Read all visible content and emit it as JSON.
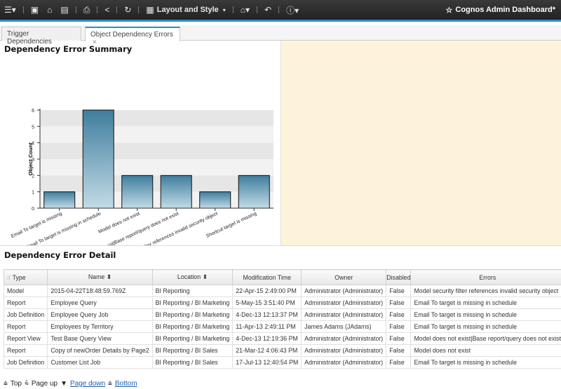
{
  "toolbar": {
    "layout_label": "Layout and Style",
    "title": "Cognos Admin Dashboard*"
  },
  "tabs": [
    {
      "label": "Trigger Dependencies"
    },
    {
      "label": "Object Dependency Errors"
    }
  ],
  "summary": {
    "title": "Dependency Error Summary"
  },
  "chart_data": {
    "type": "bar",
    "ylabel": "Object Count",
    "ylim": [
      0,
      6
    ],
    "yticks": [
      0,
      1,
      2,
      3,
      4,
      5,
      6
    ],
    "grid": true,
    "categories": [
      "Email To target is missing",
      "Email To target is missing in schedule",
      "Model does not exist",
      "Model does not exist|Base report/query does not exist",
      "Model security filter references invalid security object",
      "Shortcut target is missing"
    ],
    "values": [
      1,
      6,
      2,
      2,
      1,
      2
    ],
    "bar_color": "#4a88a8"
  },
  "detail": {
    "title": "Dependency Error Detail",
    "columns": [
      "Type",
      "Name",
      "Location",
      "Modification Time",
      "Owner",
      "Disabled",
      "Errors"
    ],
    "rows": [
      [
        "Model",
        "2015-04-22T18:48:59.769Z",
        "BI Reporting",
        "22-Apr-15 2:49:00 PM",
        "Administrator (Administrator)",
        "False",
        "Model security filter references invalid security object"
      ],
      [
        "Report",
        "Employee Query",
        "BI Reporting / BI Marketing",
        "5-May-15 3:51:40 PM",
        "Administrator (Administrator)",
        "False",
        "Email To target is missing in schedule"
      ],
      [
        "Job Definition",
        "Employee Query Job",
        "BI Reporting / BI Marketing",
        "4-Dec-13 12:13:37 PM",
        "Administrator (Administrator)",
        "False",
        "Email To target is missing in schedule"
      ],
      [
        "Report",
        "Employees by Territory",
        "BI Reporting / BI Marketing",
        "11-Apr-13 2:49:11 PM",
        "James Adams (JAdams)",
        "False",
        "Email To target is missing in schedule"
      ],
      [
        "Report View",
        "Test Base Query View",
        "BI Reporting / BI Marketing",
        "4-Dec-13 12:19:36 PM",
        "Administrator (Administrator)",
        "False",
        "Model does not exist|Base report/query does not exist"
      ],
      [
        "Report",
        "Copy of newOrder Details by Page2",
        "BI Reporting / BI Sales",
        "21-Mar-12 4:06:43 PM",
        "Administrator (Administrator)",
        "False",
        "Model does not exist"
      ],
      [
        "Job Definition",
        "Customer List Job",
        "BI Reporting / BI Sales",
        "17-Jul-13 12:40:54 PM",
        "Administrator (Administrator)",
        "False",
        "Email To target is missing in schedule"
      ]
    ]
  },
  "footer": {
    "top": "Top",
    "page_up": "Page up",
    "page_down": "Page down",
    "bottom": "Bottom"
  }
}
